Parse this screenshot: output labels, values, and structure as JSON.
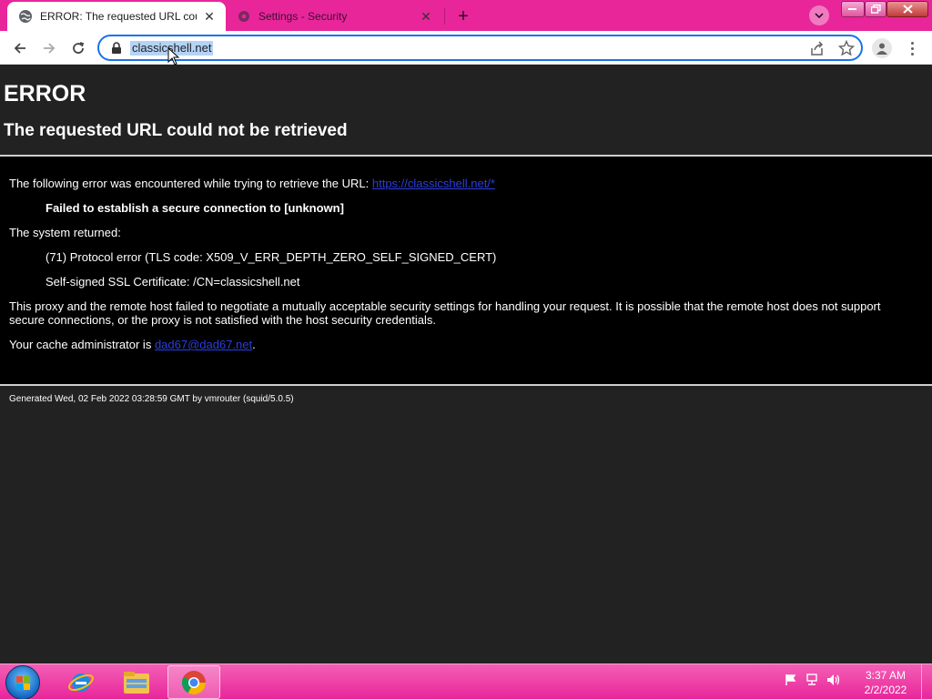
{
  "tabs": [
    {
      "title": "ERROR: The requested URL could not be retrieved",
      "icon": "globe-icon",
      "active": true
    },
    {
      "title": "Settings - Security",
      "icon": "gear-icon",
      "active": false
    }
  ],
  "omnibox": {
    "url": "classicshell.net"
  },
  "page": {
    "heading": "ERROR",
    "subheading": "The requested URL could not be retrieved",
    "intro": "The following error was encountered while trying to retrieve the URL: ",
    "intro_link": "https://classicshell.net/*",
    "error_line": "Failed to establish a secure connection to [unknown]",
    "system_returned": "The system returned:",
    "protocol_error": "(71) Protocol error (TLS code: X509_V_ERR_DEPTH_ZERO_SELF_SIGNED_CERT)",
    "cert_line": "Self-signed SSL Certificate: /CN=classicshell.net",
    "explanation": "This proxy and the remote host failed to negotiate a mutually acceptable security settings for handling your request. It is possible that the remote host does not support secure connections, or the proxy is not satisfied with the host security credentials.",
    "admin_prefix": "Your cache administrator is ",
    "admin_link": "dad67@dad67.net",
    "admin_suffix": ".",
    "footer": "Generated Wed, 02 Feb 2022 03:28:59 GMT by vmrouter (squid/5.0.5)"
  },
  "taskbar": {
    "apps": [
      "internet-explorer-icon",
      "windows-explorer-icon",
      "chrome-icon"
    ],
    "clock_time": "3:37 AM",
    "clock_date": "2/2/2022"
  },
  "colors": {
    "titlebar": "#e8269a",
    "page_bg": "#222222",
    "box_bg": "#000000",
    "link": "#2a3ee0",
    "accent": "#1a73e8"
  }
}
